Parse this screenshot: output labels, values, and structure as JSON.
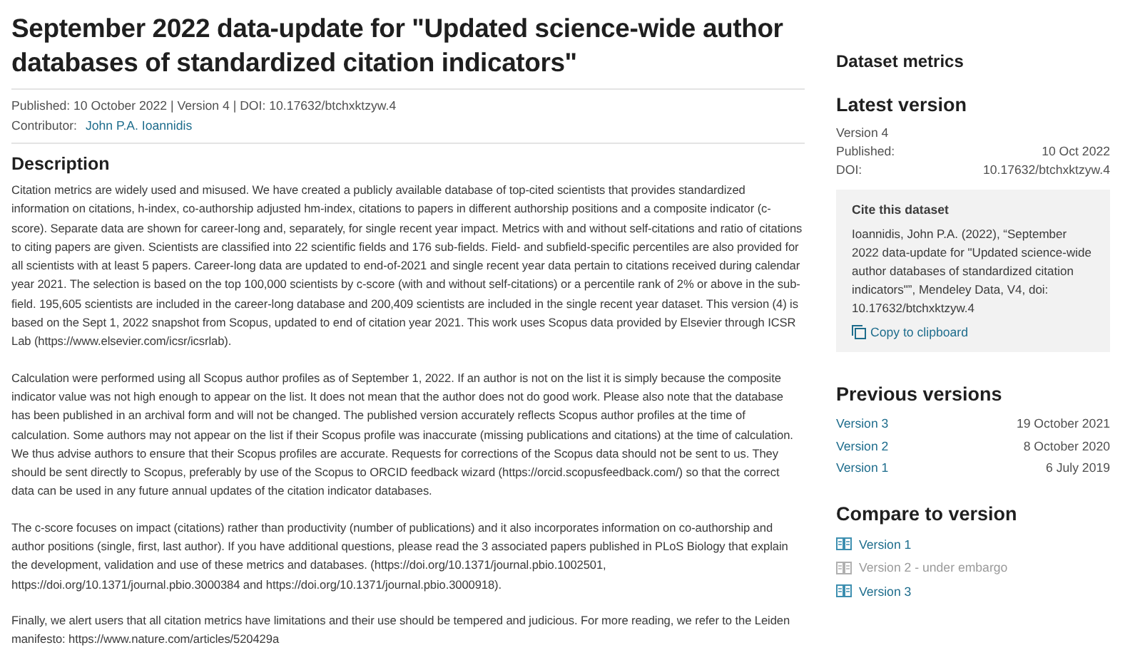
{
  "title": "September 2022 data-update for \"Updated science-wide author databases of standardized citation indicators\"",
  "meta": {
    "published": "Published: 10 October 2022 | Version 4 | DOI: 10.17632/btchxktzyw.4",
    "contributor_label": "Contributor:",
    "contributor": "John P.A. Ioannidis"
  },
  "description": {
    "heading": "Description",
    "paragraphs": [
      "Citation metrics are widely used and misused. We have created a publicly available database of top-cited scientists that provides standardized information on citations, h-index, co-authorship adjusted hm-index, citations to papers in different authorship positions and a composite indicator (c-score). Separate data are shown for career-long and, separately, for single recent year impact. Metrics with and without self-citations and ratio of citations to citing papers are given. Scientists are classified into 22 scientific fields and 176 sub-fields. Field- and subfield-specific percentiles are also provided for all scientists with at least 5 papers. Career-long data are updated to end-of-2021 and single recent year data pertain to citations received during calendar year 2021. The selection is based on the top 100,000 scientists by c-score (with and without self-citations) or a percentile rank of 2% or above in the sub-field. 195,605 scientists are included in the career-long database and 200,409 scientists are included in the single recent year dataset. This version (4) is based on the Sept 1, 2022 snapshot from Scopus, updated to end of citation year 2021. This work uses Scopus data provided by Elsevier through ICSR Lab (https://www.elsevier.com/icsr/icsrlab).",
      "Calculation were performed using all Scopus author profiles as of September 1, 2022. If an author is not on the list it is simply because the composite indicator value was not high enough to appear on the list. It does not mean that the author does not do good work.  Please also note that the database has been published in an archival form and will not be changed. The published version accurately reflects Scopus author profiles at the time of calculation.  Some authors may not appear on the list if their Scopus profile was inaccurate (missing publications and citations) at the time of calculation. We thus advise authors to ensure that their Scopus profiles are accurate. Requests for corrections of the Scopus data should not be sent to us. They should be sent directly to Scopus, preferably by use of the Scopus to ORCID feedback wizard (https://orcid.scopusfeedback.com/) so that the correct data can be used in any future annual updates of the citation indicator databases.",
      "The c-score focuses on impact (citations) rather than productivity (number of publications) and it also incorporates information on co-authorship and author positions (single, first, last author). If you have additional questions, please read the 3 associated papers published in PLoS Biology that explain the development, validation and use of these metrics and databases. (https://doi.org/10.1371/journal.pbio.1002501, https://doi.org/10.1371/journal.pbio.3000384 and https://doi.org/10.1371/journal.pbio.3000918).",
      "Finally, we alert users that all citation metrics have limitations and their use should be tempered and judicious. For more reading, we refer to the Leiden manifesto: https://www.nature.com/articles/520429a"
    ]
  },
  "sidebar": {
    "metrics_heading": "Dataset metrics",
    "latest": {
      "heading": "Latest version",
      "version": "Version 4",
      "rows": [
        {
          "label": "Published:",
          "value": "10 Oct 2022"
        },
        {
          "label": "DOI:",
          "value": "10.17632/btchxktzyw.4"
        }
      ]
    },
    "cite": {
      "heading": "Cite this dataset",
      "text": "Ioannidis, John P.A. (2022), “September 2022 data-update for \"Updated science-wide author databases of standardized citation indicators\"”, Mendeley Data, V4, doi: 10.17632/btchxktzyw.4",
      "copy": "Copy to clipboard"
    },
    "previous": {
      "heading": "Previous versions",
      "items": [
        {
          "label": "Version 3",
          "date": "19 October 2021"
        },
        {
          "label": "Version 2",
          "date": "8 October 2020"
        },
        {
          "label": "Version 1",
          "date": "6 July 2019"
        }
      ]
    },
    "compare": {
      "heading": "Compare to version",
      "items": [
        {
          "label": "Version 1",
          "disabled": false
        },
        {
          "label": "Version 2 - under embargo",
          "disabled": true
        },
        {
          "label": "Version 3",
          "disabled": false
        }
      ]
    }
  }
}
